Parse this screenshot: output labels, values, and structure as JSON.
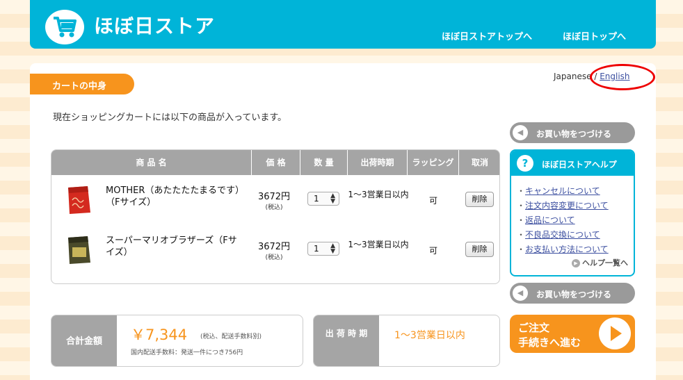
{
  "header": {
    "logo_text": "ほぼ日ストア",
    "nav": [
      "ほぼ日ストアトップへ",
      "ほぼ日トップへ"
    ]
  },
  "cart_tab": "カートの中身",
  "language": {
    "current": "Japanese",
    "separator": "/",
    "other": "English"
  },
  "intro": "現在ショッピングカートには以下の商品が入っています。",
  "table": {
    "headers": [
      "商 品 名",
      "価 格",
      "数 量",
      "出荷時期",
      "ラッピング",
      "取消"
    ],
    "rows": [
      {
        "name": "MOTHER（あたたたたまるです）（Fサイズ）",
        "price": "3672円",
        "tax": "(税込)",
        "qty": "1",
        "ship": "1〜3営業日以内",
        "wrap": "可",
        "delete": "削除"
      },
      {
        "name": "スーパーマリオブラザーズ（Fサイズ）",
        "price": "3672円",
        "tax": "(税込)",
        "qty": "1",
        "ship": "1〜3営業日以内",
        "wrap": "可",
        "delete": "削除"
      }
    ]
  },
  "continue_shopping": "お買い物をつづける",
  "help": {
    "title": "ほぼ日ストアヘルプ",
    "links": [
      "キャンセルについて",
      "注文内容変更について",
      "返品について",
      "不良品交換について",
      "お支払い方法について"
    ],
    "all": "ヘルプ一覧へ"
  },
  "total": {
    "label": "合計金額",
    "amount": "￥7,344",
    "note": "(税込、配送手数料別)",
    "shipping_fee": "国内配送手数料：発送一件につき756円"
  },
  "ship_period": {
    "label": "出 荷 時 期",
    "value": "1〜3営業日以内"
  },
  "order_button": {
    "line1": "ご注文",
    "line2": "手続きへ進む"
  },
  "colors": {
    "header": "#00b4d8",
    "accent": "#f7941d",
    "gray": "#a5a5a5",
    "highlight_circle": "#ee0000"
  }
}
